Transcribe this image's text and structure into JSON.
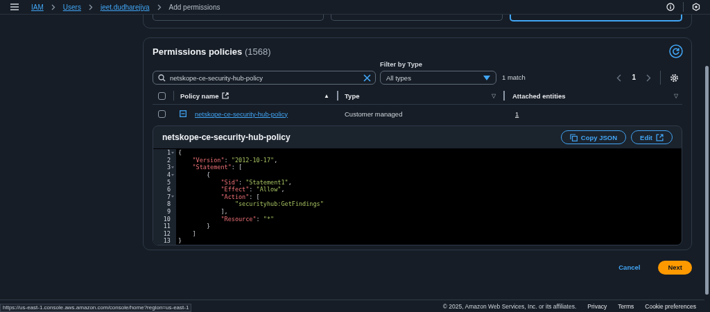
{
  "breadcrumbs": {
    "links": [
      "IAM",
      "Users",
      "jeet.dudharejiya"
    ],
    "current": "Add permissions"
  },
  "panel": {
    "title": "Permissions policies",
    "count": "(1568)",
    "search": {
      "value": "netskope-ce-security-hub-policy"
    },
    "filter": {
      "label": "Filter by Type",
      "value": "All types"
    },
    "matches": "1 match",
    "page": "1",
    "select_all_checked": false,
    "columns": [
      {
        "label": "Policy name",
        "sort_icon": "▲",
        "sort_active": true,
        "external": true
      },
      {
        "label": "Type",
        "sort_icon": "▽",
        "sort_active": false,
        "external": false
      },
      {
        "label": "Attached entities",
        "sort_icon": "▽",
        "sort_active": false,
        "external": false
      }
    ],
    "rows": [
      {
        "checked": false,
        "expanded": true,
        "name": "netskope-ce-security-hub-policy",
        "type": "Customer managed",
        "attached": "1"
      }
    ],
    "detail": {
      "title": "netskope-ce-security-hub-policy",
      "copy": "Copy JSON",
      "edit": "Edit",
      "lines": [
        {
          "n": "1",
          "fold": true,
          "tokens": [
            {
              "kind": "punct",
              "text": "{"
            }
          ]
        },
        {
          "n": "2",
          "fold": false,
          "tokens": [
            {
              "kind": "key",
              "text": "    \"Version\""
            },
            {
              "kind": "punct",
              "text": ": "
            },
            {
              "kind": "str",
              "text": "\"2012-10-17\""
            },
            {
              "kind": "punct",
              "text": ","
            }
          ]
        },
        {
          "n": "3",
          "fold": true,
          "tokens": [
            {
              "kind": "key",
              "text": "    \"Statement\""
            },
            {
              "kind": "punct",
              "text": ": ["
            }
          ]
        },
        {
          "n": "4",
          "fold": true,
          "tokens": [
            {
              "kind": "punct",
              "text": "        {"
            }
          ]
        },
        {
          "n": "5",
          "fold": false,
          "tokens": [
            {
              "kind": "key",
              "text": "            \"Sid\""
            },
            {
              "kind": "punct",
              "text": ": "
            },
            {
              "kind": "str",
              "text": "\"Statement1\""
            },
            {
              "kind": "punct",
              "text": ","
            }
          ]
        },
        {
          "n": "6",
          "fold": false,
          "tokens": [
            {
              "kind": "key",
              "text": "            \"Effect\""
            },
            {
              "kind": "punct",
              "text": ": "
            },
            {
              "kind": "str",
              "text": "\"Allow\""
            },
            {
              "kind": "punct",
              "text": ","
            }
          ]
        },
        {
          "n": "7",
          "fold": true,
          "tokens": [
            {
              "kind": "key",
              "text": "            \"Action\""
            },
            {
              "kind": "punct",
              "text": ": ["
            }
          ]
        },
        {
          "n": "8",
          "fold": false,
          "tokens": [
            {
              "kind": "str",
              "text": "                \"securityhub:GetFindings\""
            }
          ]
        },
        {
          "n": "9",
          "fold": false,
          "tokens": [
            {
              "kind": "punct",
              "text": "            ],"
            }
          ]
        },
        {
          "n": "10",
          "fold": false,
          "tokens": [
            {
              "kind": "key",
              "text": "            \"Resource\""
            },
            {
              "kind": "punct",
              "text": ": "
            },
            {
              "kind": "str",
              "text": "\"*\""
            }
          ]
        },
        {
          "n": "11",
          "fold": false,
          "tokens": [
            {
              "kind": "punct",
              "text": "        }"
            }
          ]
        },
        {
          "n": "12",
          "fold": false,
          "tokens": [
            {
              "kind": "punct",
              "text": "    ]"
            }
          ]
        },
        {
          "n": "13",
          "fold": false,
          "tokens": [
            {
              "kind": "punct",
              "text": "}"
            }
          ]
        }
      ]
    }
  },
  "actions": {
    "cancel": "Cancel",
    "next": "Next"
  },
  "footer": {
    "copyright": "© 2025, Amazon Web Services, Inc. or its affiliates.",
    "links": [
      "Privacy",
      "Terms",
      "Cookie preferences"
    ]
  },
  "status_url": "https://us-east-1.console.aws.amazon.com/console/home?region=us-east-1"
}
